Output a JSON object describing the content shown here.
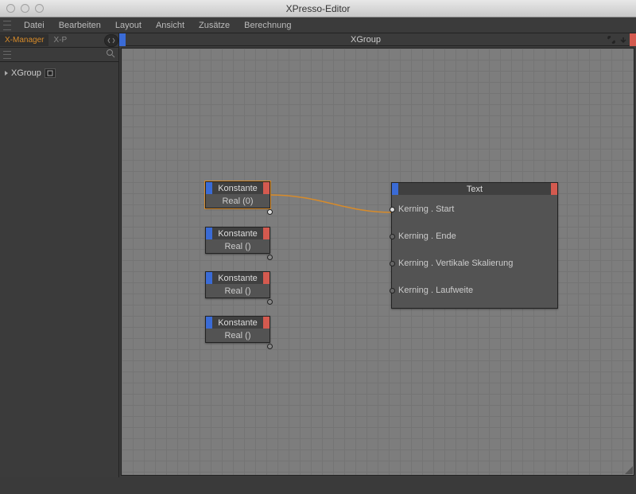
{
  "window": {
    "title": "XPresso-Editor"
  },
  "menu": {
    "items": [
      "Datei",
      "Bearbeiten",
      "Layout",
      "Ansicht",
      "Zusätze",
      "Berechnung"
    ]
  },
  "sidebar": {
    "tabs": {
      "active": "X-Manager",
      "inactive": "X-P"
    },
    "tree": {
      "root": "XGroup"
    }
  },
  "canvas": {
    "title": "XGroup"
  },
  "nodes": {
    "const": {
      "title": "Konstante",
      "out0": "Real (0)",
      "out": "Real ()"
    },
    "text": {
      "title": "Text",
      "ports": [
        "Kerning . Start",
        "Kerning . Ende",
        "Kerning . Vertikale Skalierung",
        "Kerning . Laufweite"
      ]
    }
  }
}
